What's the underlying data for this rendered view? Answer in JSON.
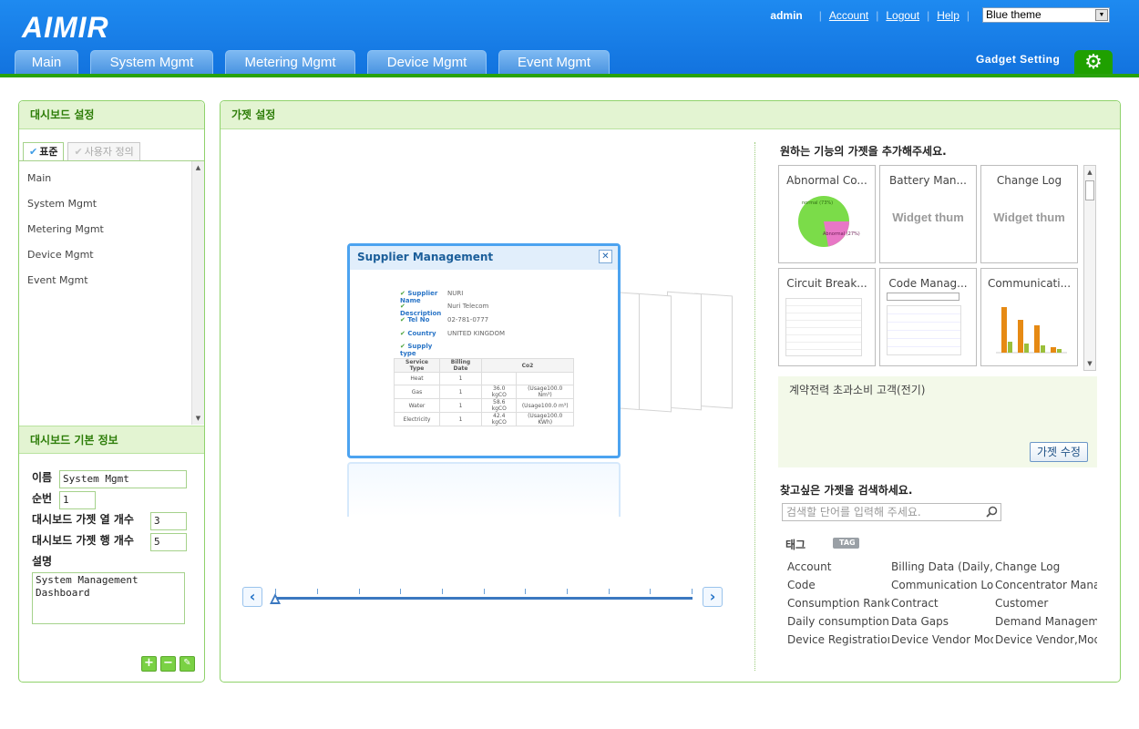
{
  "header": {
    "logo": "AIMIR",
    "user": "admin",
    "links": [
      "Account",
      "Logout",
      "Help"
    ],
    "theme": "Blue theme",
    "tabs": [
      "Main",
      "System Mgmt",
      "Metering Mgmt",
      "Device Mgmt",
      "Event Mgmt"
    ],
    "gadget_setting": "Gadget Setting"
  },
  "left_panel": {
    "title": "대시보드 설정",
    "tab_standard": "표준",
    "tab_custom": "사용자 정의",
    "items": [
      "Main",
      "System Mgmt",
      "Metering Mgmt",
      "Device Mgmt",
      "Event Mgmt"
    ]
  },
  "info_panel": {
    "title": "대시보드 기본 정보",
    "name_label": "이름",
    "name_value": "System Mgmt",
    "order_label": "순번",
    "order_value": "1",
    "cols_label": "대시보드 가젯 열 개수",
    "cols_value": "3",
    "rows_label": "대시보드 가젯 행 개수",
    "rows_value": "5",
    "desc_label": "설명",
    "desc_value": "System Management Dashboard"
  },
  "gadget_panel": {
    "title": "가젯 설정",
    "popup": {
      "title": "Supplier Management",
      "fields": [
        {
          "k": "Supplier Name",
          "v": "NURI"
        },
        {
          "k": "Description",
          "v": "Nuri Telecom"
        },
        {
          "k": "Tel No",
          "v": "02-781-0777"
        },
        {
          "k": "Country",
          "v": "UNITED KINGDOM"
        },
        {
          "k": "Supply type",
          "v": ""
        }
      ],
      "table_headers": [
        "Service Type",
        "Billing Date",
        "Co2"
      ],
      "table_rows": [
        [
          "Heat",
          "1",
          "",
          ""
        ],
        [
          "Gas",
          "1",
          "36.0 kgCO",
          "(Usage100.0 Nm³)"
        ],
        [
          "Water",
          "1",
          "58.6 kgCO",
          "(Usage100.0 m³)"
        ],
        [
          "Electricity",
          "1",
          "42.4 kgCO",
          "(Usage100.0 KWh)"
        ]
      ]
    },
    "add_heading": "원하는 기능의 가젯을 추가해주세요.",
    "widgets": [
      "Abnormal Co...",
      "Battery Man...",
      "Change Log",
      "Circuit Break...",
      "Code Manag...",
      "Communicati..."
    ],
    "thumb_text": "Widget thum",
    "pie_labels": [
      "normal (73%)",
      "Abnormal (27%)"
    ],
    "selected_desc": "계약전력 초과소비 고객(전기)",
    "edit_button": "가젯 수정",
    "search_heading": "찾고싶은 가젯을 검색하세요.",
    "search_placeholder": "검색할 단어를 입력해 주세요.",
    "tag_label": "태그",
    "tag_badge": "TAG",
    "tags": [
      "Account",
      "Billing Data (Daily,M",
      "Change Log",
      "Code",
      "Communication Log",
      "Concentrator Manag",
      "Consumption Rankir",
      "Contract",
      "Customer",
      "Daily consumption g",
      "Data Gaps",
      "Demand Manageme",
      "Device Registration",
      "Device Vendor Mod",
      "Device Vendor,Mod"
    ],
    "colors": {
      "accent": "#29a20b",
      "header": "#1e8af0",
      "panel_border": "#8fd26b"
    }
  }
}
